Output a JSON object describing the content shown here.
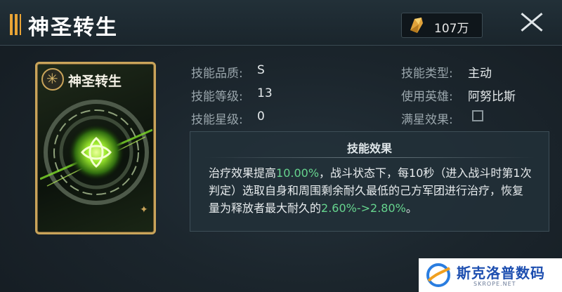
{
  "header": {
    "title": "神圣转生",
    "resource_value": "107万"
  },
  "card": {
    "name": "神圣转生"
  },
  "stats": {
    "quality_label": "技能品质:",
    "quality_value": "S",
    "level_label": "技能等级:",
    "level_value": "13",
    "star_label": "技能星级:",
    "star_value": "0",
    "type_label": "技能类型:",
    "type_value": "主动",
    "hero_label": "使用英雄:",
    "hero_value": "阿努比斯",
    "full_star_label": "满星效果:"
  },
  "effect": {
    "title": "技能效果",
    "text_1": "治疗效果提高",
    "hl_1": "10.00%",
    "text_2": "，战斗状态下，每10秒（进入战斗时第1次判定）选取自身和周围剩余耐久最低的己方军团进行治疗，恢复量为释放者最大耐久的",
    "hl_2": "2.60%->2.80%",
    "text_3": "。"
  },
  "watermark": {
    "brand": "斯克洛普数码",
    "sub": "SKROPE.NET"
  },
  "colors": {
    "highlight": "#66d48e",
    "card_border": "#c9a45a",
    "accent": "#e8a436"
  }
}
